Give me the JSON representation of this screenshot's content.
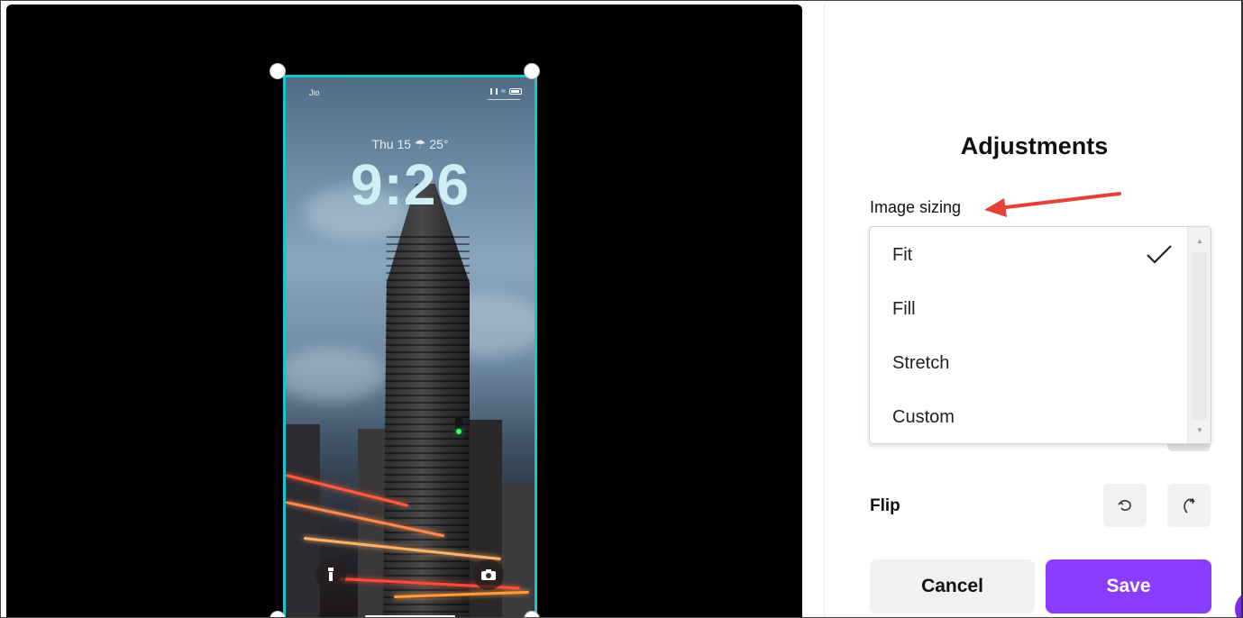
{
  "canvas": {
    "phone": {
      "carrier": "Jio",
      "date_weather": "Thu 15 ☂ 25°",
      "time": "9:26"
    }
  },
  "panel": {
    "title": "Adjustments",
    "image_sizing_label": "Image sizing",
    "dropdown": {
      "options": [
        "Fit",
        "Fill",
        "Stretch",
        "Custom"
      ],
      "selected": "Fit"
    },
    "flip_label": "Flip",
    "cancel_label": "Cancel",
    "save_label": "Save"
  },
  "colors": {
    "accent": "#8b3dff",
    "selection": "#18c5cf",
    "annotation_arrow": "#e5413a"
  },
  "icons": [
    "check-icon",
    "flip-horizontal-icon",
    "flip-vertical-icon",
    "flashlight-icon",
    "camera-icon",
    "wifi-icon",
    "battery-icon"
  ]
}
